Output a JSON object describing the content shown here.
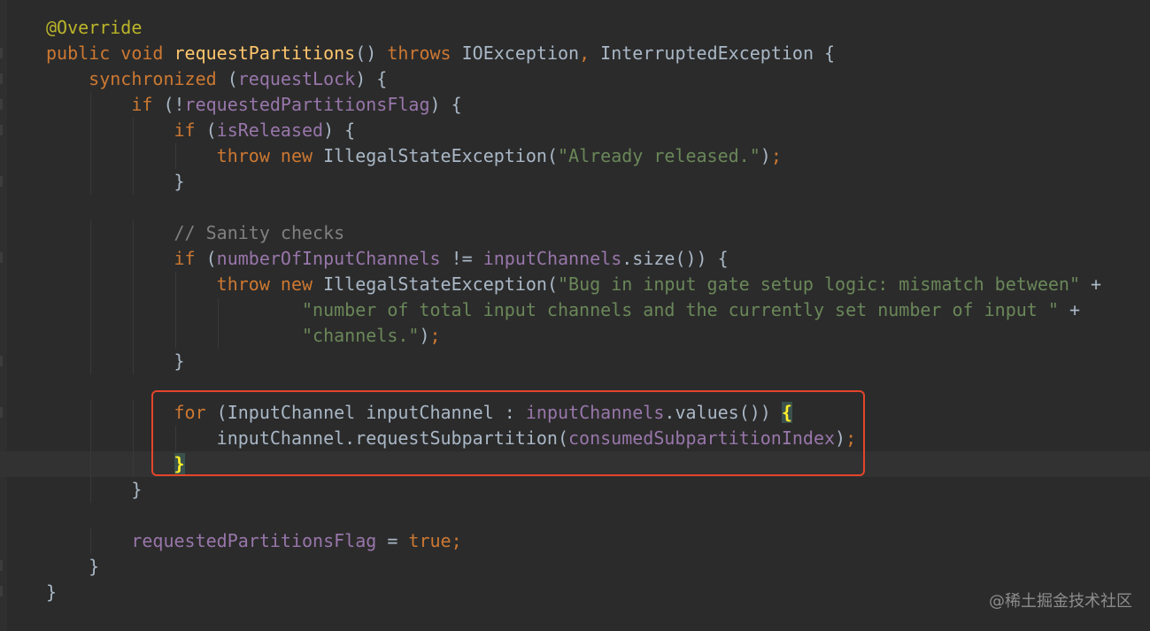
{
  "code_lines": [
    {
      "tokens": [
        {
          "t": "@Override",
          "c": "ann"
        }
      ]
    },
    {
      "tokens": [
        {
          "t": "public void ",
          "c": "kw"
        },
        {
          "t": "requestPartitions",
          "c": "fn"
        },
        {
          "t": "() ",
          "c": "plain"
        },
        {
          "t": "throws ",
          "c": "kw"
        },
        {
          "t": "IOException",
          "c": "plain"
        },
        {
          "t": ", ",
          "c": "kw"
        },
        {
          "t": "InterruptedException {",
          "c": "plain"
        }
      ]
    },
    {
      "tokens": [
        {
          "t": "    synchronized ",
          "c": "kw"
        },
        {
          "t": "(",
          "c": "plain"
        },
        {
          "t": "requestLock",
          "c": "fld"
        },
        {
          "t": ") {",
          "c": "plain"
        }
      ]
    },
    {
      "tokens": [
        {
          "t": "        if ",
          "c": "kw"
        },
        {
          "t": "(!",
          "c": "plain"
        },
        {
          "t": "requestedPartitionsFlag",
          "c": "fld"
        },
        {
          "t": ") {",
          "c": "plain"
        }
      ]
    },
    {
      "tokens": [
        {
          "t": "            if ",
          "c": "kw"
        },
        {
          "t": "(",
          "c": "plain"
        },
        {
          "t": "isReleased",
          "c": "fld"
        },
        {
          "t": ") {",
          "c": "plain"
        }
      ]
    },
    {
      "tokens": [
        {
          "t": "                throw new ",
          "c": "kw"
        },
        {
          "t": "IllegalStateException(",
          "c": "plain"
        },
        {
          "t": "\"Already released.\"",
          "c": "str"
        },
        {
          "t": ")",
          "c": "plain"
        },
        {
          "t": ";",
          "c": "kw"
        }
      ]
    },
    {
      "tokens": [
        {
          "t": "            }",
          "c": "plain"
        }
      ]
    },
    {
      "tokens": []
    },
    {
      "tokens": [
        {
          "t": "            // Sanity checks",
          "c": "cmt"
        }
      ]
    },
    {
      "tokens": [
        {
          "t": "            if ",
          "c": "kw"
        },
        {
          "t": "(",
          "c": "plain"
        },
        {
          "t": "numberOfInputChannels",
          "c": "fld"
        },
        {
          "t": " != ",
          "c": "plain"
        },
        {
          "t": "inputChannels",
          "c": "fld"
        },
        {
          "t": ".size()) {",
          "c": "plain"
        }
      ]
    },
    {
      "tokens": [
        {
          "t": "                throw new ",
          "c": "kw"
        },
        {
          "t": "IllegalStateException(",
          "c": "plain"
        },
        {
          "t": "\"Bug in input gate setup logic: mismatch between\"",
          "c": "str"
        },
        {
          "t": " +",
          "c": "plain"
        }
      ]
    },
    {
      "tokens": [
        {
          "t": "                        ",
          "c": "plain"
        },
        {
          "t": "\"number of total input channels and the currently set number of input \"",
          "c": "str"
        },
        {
          "t": " +",
          "c": "plain"
        }
      ]
    },
    {
      "tokens": [
        {
          "t": "                        ",
          "c": "plain"
        },
        {
          "t": "\"channels.\"",
          "c": "str"
        },
        {
          "t": ")",
          "c": "plain"
        },
        {
          "t": ";",
          "c": "kw"
        }
      ]
    },
    {
      "tokens": [
        {
          "t": "            }",
          "c": "plain"
        }
      ]
    },
    {
      "tokens": []
    },
    {
      "tokens": [
        {
          "t": "            for ",
          "c": "kw"
        },
        {
          "t": "(InputChannel inputChannel : ",
          "c": "plain"
        },
        {
          "t": "inputChannels",
          "c": "fld"
        },
        {
          "t": ".values()) ",
          "c": "plain"
        },
        {
          "t": "{",
          "c": "brace-hl"
        }
      ]
    },
    {
      "tokens": [
        {
          "t": "                inputChannel.requestSubpartition(",
          "c": "plain"
        },
        {
          "t": "consumedSubpartitionIndex",
          "c": "fld"
        },
        {
          "t": ")",
          "c": "plain"
        },
        {
          "t": ";",
          "c": "kw"
        }
      ]
    },
    {
      "tokens": [
        {
          "t": "            ",
          "c": "plain"
        },
        {
          "t": "}",
          "c": "brace-hl"
        }
      ],
      "caret": true
    },
    {
      "tokens": [
        {
          "t": "        }",
          "c": "plain"
        }
      ]
    },
    {
      "tokens": []
    },
    {
      "tokens": [
        {
          "t": "        ",
          "c": "plain"
        },
        {
          "t": "requestedPartitionsFlag",
          "c": "fld"
        },
        {
          "t": " = ",
          "c": "plain"
        },
        {
          "t": "true",
          "c": "kw"
        },
        {
          "t": ";",
          "c": "kw"
        }
      ]
    },
    {
      "tokens": [
        {
          "t": "    }",
          "c": "plain"
        }
      ]
    },
    {
      "tokens": [
        {
          "t": "}",
          "c": "plain"
        }
      ]
    }
  ],
  "watermark": "@稀土掘金技术社区",
  "colors": {
    "background": "#2b2b2b",
    "keyword": "#cc7832",
    "annotation": "#bbb529",
    "method": "#ffc66d",
    "field": "#9876aa",
    "string": "#6a8759",
    "comment": "#808080",
    "text": "#a9b7c6",
    "highlight_box": "#e3452b"
  }
}
